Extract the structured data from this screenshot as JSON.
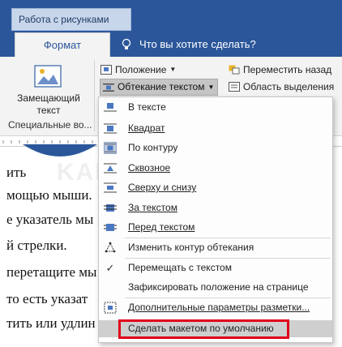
{
  "ribbon": {
    "context_tab": "Работа с рисунками",
    "active_tab": "Формат",
    "tell_me": "Что вы хотите сделать?",
    "placeholder_label_1": "Замещающий",
    "placeholder_label_2": "текст",
    "group_label": "Специальные во...",
    "position": "Положение",
    "wrap_text": "Обтекание текстом",
    "move_back": "Переместить назад",
    "selection_pane": "Область выделения"
  },
  "document": {
    "lines": [
      "ить",
      "мощью мыши.",
      "е  указатель  мы",
      "й стрелки.",
      "перетащите мы",
      " то есть указат",
      "тить или удлин"
    ]
  },
  "watermark": "KAK-SDELAT.ORG",
  "menu": {
    "items": [
      {
        "label": "В тексте",
        "icon": "inline-with-text-icon"
      },
      {
        "label": "Квадрат",
        "icon": "wrap-square-icon"
      },
      {
        "label": "По контуру",
        "icon": "wrap-tight-icon"
      },
      {
        "label": "Сквозное",
        "icon": "wrap-through-icon"
      },
      {
        "label": "Сверху и снизу",
        "icon": "wrap-top-bottom-icon"
      },
      {
        "label": "За текстом",
        "icon": "behind-text-icon"
      },
      {
        "label": "Перед текстом",
        "icon": "in-front-of-text-icon"
      },
      {
        "label": "Изменить контур обтекания",
        "icon": "edit-wrap-points-icon"
      },
      {
        "label": "Перемещать с текстом",
        "icon": "checkmark-icon"
      },
      {
        "label": "Зафиксировать положение на странице",
        "icon": ""
      },
      {
        "label": "Дополнительные параметры разметки...",
        "icon": "layout-options-icon"
      },
      {
        "label": "Сделать макетом по умолчанию",
        "icon": ""
      }
    ]
  },
  "colors": {
    "ribbon_blue": "#2b579a",
    "highlight_red": "#e0001b",
    "selected_icon": "#bfcbe0"
  }
}
